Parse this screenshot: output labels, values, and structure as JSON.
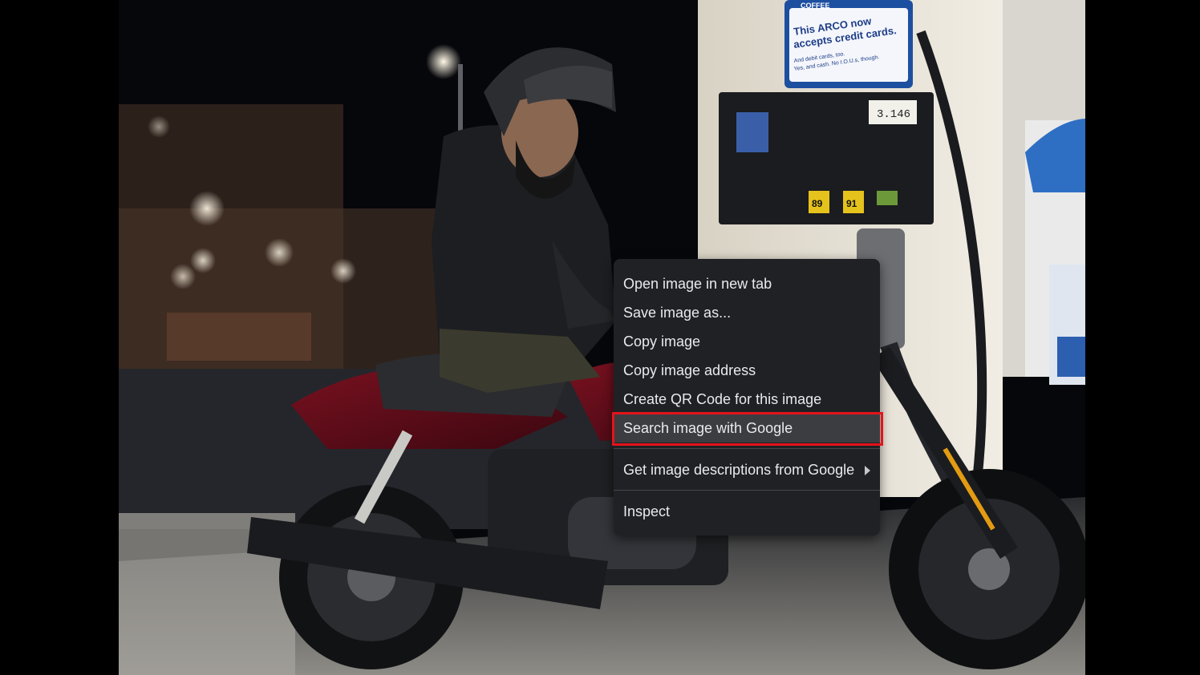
{
  "photo": {
    "signage": {
      "brand_top": "COFFEE",
      "ad_line1": "This ARCO now",
      "ad_line2": "accepts credit cards.",
      "ad_line3": "And debit cards, too.",
      "ad_line4": "Yes, and cash. No I.O.U.s, though.",
      "grade_89": "89",
      "grade_91": "91",
      "price_display": "3.146"
    }
  },
  "context_menu": {
    "items": [
      {
        "label": "Open image in new tab"
      },
      {
        "label": "Save image as..."
      },
      {
        "label": "Copy image"
      },
      {
        "label": "Copy image address"
      },
      {
        "label": "Create QR Code for this image"
      },
      {
        "label": "Search image with Google"
      },
      {
        "label": "Get image descriptions from Google"
      },
      {
        "label": "Inspect"
      }
    ],
    "highlighted_index": 5,
    "highlight_outline_color": "#e3141b",
    "background_color": "#202124",
    "text_color": "#e8eaed"
  }
}
